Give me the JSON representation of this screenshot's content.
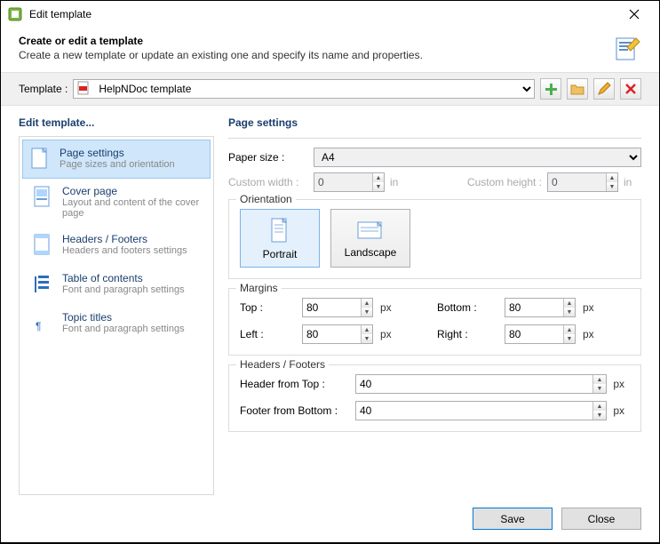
{
  "window": {
    "title": "Edit template"
  },
  "header": {
    "title": "Create or edit a template",
    "subtitle": "Create a new template or update an existing one and specify its name and properties."
  },
  "templatebar": {
    "label": "Template :",
    "selected": "HelpNDoc template"
  },
  "sidebar": {
    "title": "Edit template...",
    "items": [
      {
        "title": "Page settings",
        "desc": "Page sizes and orientation"
      },
      {
        "title": "Cover page",
        "desc": "Layout and content of the cover page"
      },
      {
        "title": "Headers / Footers",
        "desc": "Headers and footers settings"
      },
      {
        "title": "Table of contents",
        "desc": "Font and paragraph settings"
      },
      {
        "title": "Topic titles",
        "desc": "Font and paragraph settings"
      }
    ]
  },
  "main": {
    "title": "Page settings",
    "paper_size_label": "Paper size :",
    "paper_size_value": "A4",
    "custom_width_label": "Custom width :",
    "custom_width_value": "0",
    "custom_height_label": "Custom height :",
    "custom_height_value": "0",
    "unit_in": "in",
    "unit_px": "px",
    "orientation": {
      "legend": "Orientation",
      "portrait": "Portrait",
      "landscape": "Landscape"
    },
    "margins": {
      "legend": "Margins",
      "top_label": "Top :",
      "top_value": "80",
      "bottom_label": "Bottom :",
      "bottom_value": "80",
      "left_label": "Left :",
      "left_value": "80",
      "right_label": "Right :",
      "right_value": "80"
    },
    "hf": {
      "legend": "Headers / Footers",
      "header_label": "Header from Top :",
      "header_value": "40",
      "footer_label": "Footer from Bottom :",
      "footer_value": "40"
    }
  },
  "footer": {
    "save": "Save",
    "close": "Close"
  }
}
